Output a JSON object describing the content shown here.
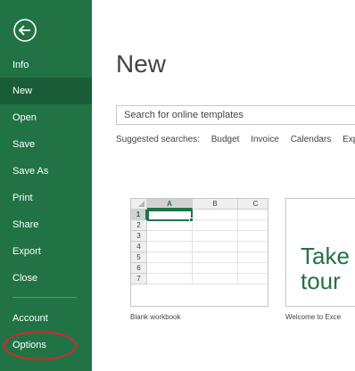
{
  "sidebar": {
    "items": [
      {
        "label": "Info"
      },
      {
        "label": "New"
      },
      {
        "label": "Open"
      },
      {
        "label": "Save"
      },
      {
        "label": "Save As"
      },
      {
        "label": "Print"
      },
      {
        "label": "Share"
      },
      {
        "label": "Export"
      },
      {
        "label": "Close"
      },
      {
        "label": "Account"
      },
      {
        "label": "Options"
      }
    ],
    "active": "New",
    "highlighted": "Options",
    "bg_color": "#217346",
    "highlight_color": "#d6262b"
  },
  "main": {
    "title": "New",
    "search": {
      "placeholder": "Search for online templates"
    },
    "suggested": {
      "label": "Suggested searches:",
      "items": [
        "Budget",
        "Invoice",
        "Calendars",
        "Exp"
      ]
    },
    "templates": [
      {
        "label": "Blank workbook"
      },
      {
        "label": "Welcome to Exce"
      }
    ],
    "workbook_preview": {
      "columns": [
        "A",
        "B",
        "C"
      ],
      "rows": [
        "1",
        "2",
        "3",
        "4",
        "5",
        "6",
        "7"
      ]
    },
    "tour_preview": {
      "line1": "Take",
      "line2": "tour"
    }
  }
}
